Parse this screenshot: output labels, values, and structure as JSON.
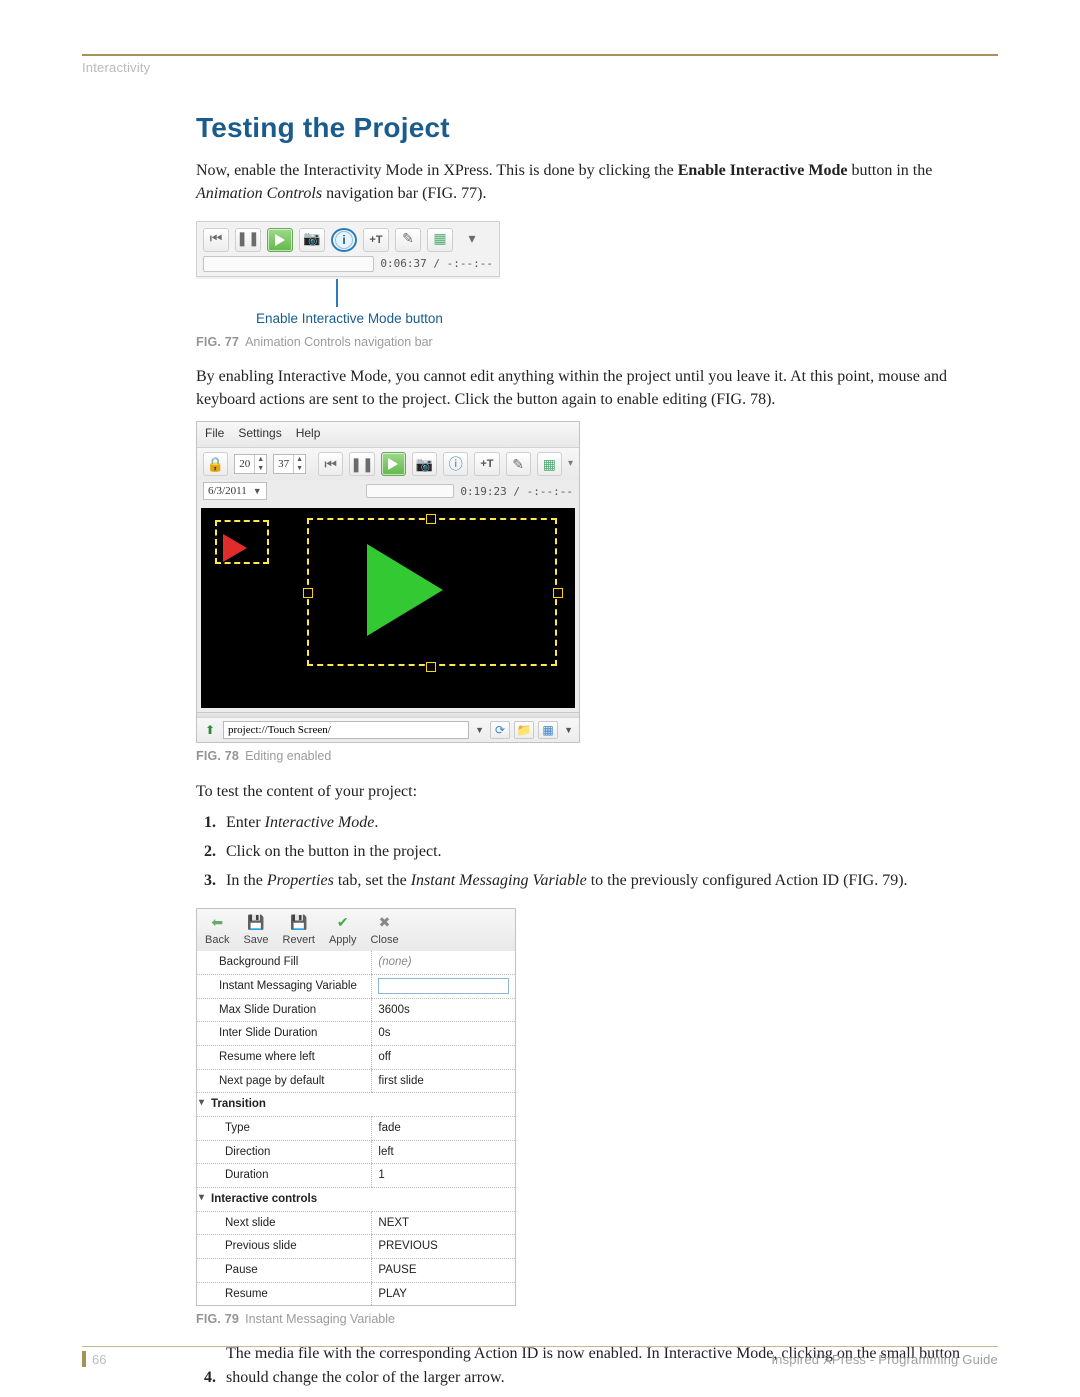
{
  "header": {
    "breadcrumb": "Interactivity"
  },
  "title": "Testing the Project",
  "p1": {
    "pre": "Now, enable the Interactivity Mode in XPress. This is done by clicking the ",
    "bold": "Enable Interactive Mode",
    "mid": " button in the ",
    "italic": "Animation Controls",
    "post": " navigation bar (FIG. 77)."
  },
  "fig77": {
    "callout": "Enable Interactive Mode button",
    "caption_num": "FIG. 77",
    "caption": "Animation Controls navigation bar",
    "timecode": "0:06:37 / -:--:--",
    "icons": {
      "first": "first-frame-icon",
      "pause": "pause-icon",
      "play": "play-icon",
      "camera": "camera-icon",
      "info": "info-icon",
      "addT": "+T",
      "edit": "edit-icon",
      "layers": "layers-icon",
      "menu": "dropdown-icon"
    }
  },
  "p2": "By enabling Interactive Mode, you cannot edit anything within the project until you leave it. At this point, mouse and keyboard actions are sent to the project. Click the button again to enable editing (FIG. 78).",
  "fig78": {
    "caption_num": "FIG. 78",
    "caption": "Editing enabled",
    "menu": {
      "file": "File",
      "settings": "Settings",
      "help": "Help"
    },
    "spin1": "20",
    "spin2": "37",
    "date": "6/3/2011",
    "timecode": "0:19:23 / -:--:--",
    "path": "project://Touch Screen/"
  },
  "p3": "To test the content of your project:",
  "steps": {
    "s1_pre": "Enter ",
    "s1_italic": "Interactive Mode",
    "s1_post": ".",
    "s2": "Click on the button in the project.",
    "s3_pre": "In the ",
    "s3_i1": "Properties",
    "s3_mid": " tab, set the ",
    "s3_i2": "Instant Messaging Variable",
    "s3_post": " to the previously configured Action ID (FIG. 79).",
    "s4": "The media file with the corresponding Action ID is now enabled. In Interactive Mode, clicking on the small button should change the color of the larger arrow."
  },
  "fig79": {
    "caption_num": "FIG. 79",
    "caption": "Instant Messaging Variable",
    "actions": {
      "back": "Back",
      "save": "Save",
      "revert": "Revert",
      "apply": "Apply",
      "close": "Close"
    },
    "rows": {
      "bg_fill_lbl": "Background Fill",
      "bg_fill_val": "(none)",
      "im_label": "Instant Messaging Variable",
      "max_lbl": "Max Slide Duration",
      "max_val": "3600s",
      "inter_lbl": "Inter Slide Duration",
      "inter_val": "0s",
      "resume_lbl": "Resume where left",
      "resume_val": "off",
      "next_lbl": "Next page by default",
      "next_val": "first slide",
      "transition": "Transition",
      "type_lbl": "Type",
      "type_val": "fade",
      "dir_lbl": "Direction",
      "dir_val": "left",
      "dur_lbl": "Duration",
      "dur_val": "1",
      "interactive": "Interactive controls",
      "nexts_lbl": "Next slide",
      "nexts_val": "NEXT",
      "prevs_lbl": "Previous slide",
      "prevs_val": "PREVIOUS",
      "pause_lbl": "Pause",
      "pause_val": "PAUSE",
      "resumec_lbl": "Resume",
      "resumec_val": "PLAY"
    }
  },
  "footer": {
    "page": "66",
    "doc": "Inspired XPress - Programming Guide"
  }
}
